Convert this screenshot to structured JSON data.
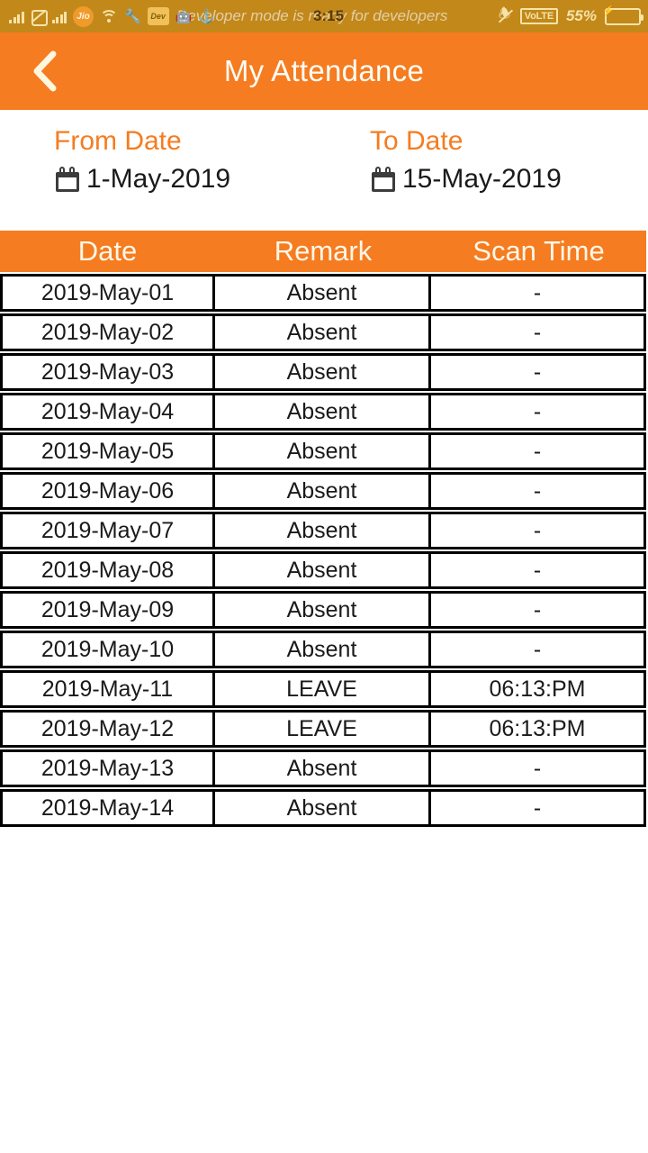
{
  "status_bar": {
    "signal_left_icon": "signal-bars-icon",
    "no_sim_icon": "no-sim-icon",
    "signal_right_icon": "signal-bars-icon",
    "carrier": "Jio",
    "wifi_icon": "wifi-icon",
    "wrench_icon": "wrench-icon",
    "developer_card_text": "Dev",
    "android_icon": "android-robot-icon",
    "anchor_icon": "anchor-icon",
    "ticker_text": "Developer mode is ready for developers",
    "time": "3:15",
    "silent_icon": "bell-muted-icon",
    "volte_label": "VoLTE",
    "battery_percent": "55%",
    "battery_icon": "battery-charging-icon",
    "bolt_glyph": "⚡",
    "bg_color": "#C2881A",
    "fg_color": "#F6E3A8"
  },
  "appbar": {
    "back_icon": "chevron-left-icon",
    "title": "My Attendance",
    "bg_color": "#F57C20",
    "title_color": "#FFFDF6"
  },
  "filters": {
    "from": {
      "label": "From Date",
      "icon": "calendar-icon",
      "value": "1-May-2019"
    },
    "to": {
      "label": "To Date",
      "icon": "calendar-icon",
      "value": "15-May-2019"
    },
    "label_color": "#F57C20"
  },
  "attendance_table": {
    "columns": [
      "Date",
      "Remark",
      "Scan Time"
    ],
    "rows": [
      {
        "date": "2019-May-01",
        "remark": "Absent",
        "scan_time": "-"
      },
      {
        "date": "2019-May-02",
        "remark": "Absent",
        "scan_time": "-"
      },
      {
        "date": "2019-May-03",
        "remark": "Absent",
        "scan_time": "-"
      },
      {
        "date": "2019-May-04",
        "remark": "Absent",
        "scan_time": "-"
      },
      {
        "date": "2019-May-05",
        "remark": "Absent",
        "scan_time": "-"
      },
      {
        "date": "2019-May-06",
        "remark": "Absent",
        "scan_time": "-"
      },
      {
        "date": "2019-May-07",
        "remark": "Absent",
        "scan_time": "-"
      },
      {
        "date": "2019-May-08",
        "remark": "Absent",
        "scan_time": "-"
      },
      {
        "date": "2019-May-09",
        "remark": "Absent",
        "scan_time": "-"
      },
      {
        "date": "2019-May-10",
        "remark": "Absent",
        "scan_time": "-"
      },
      {
        "date": "2019-May-11",
        "remark": "LEAVE",
        "scan_time": "06:13:PM"
      },
      {
        "date": "2019-May-12",
        "remark": "LEAVE",
        "scan_time": "06:13:PM"
      },
      {
        "date": "2019-May-13",
        "remark": "Absent",
        "scan_time": "-"
      },
      {
        "date": "2019-May-14",
        "remark": "Absent",
        "scan_time": "-"
      }
    ],
    "header_bg": "#F57C20",
    "header_fg": "#FFF7E8",
    "border_color": "#000000"
  }
}
